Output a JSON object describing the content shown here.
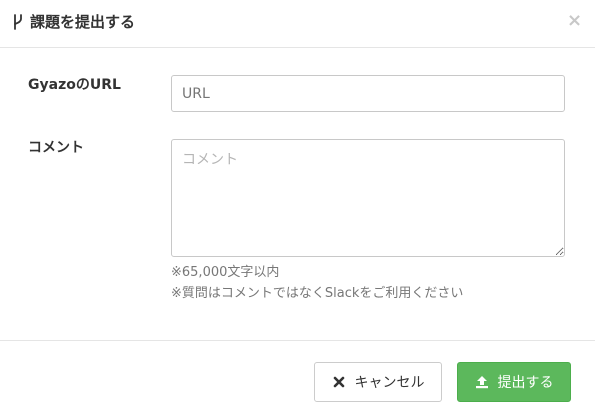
{
  "dialog": {
    "title": "課題を提出する",
    "title_icon": "branch-icon",
    "close_label": "×"
  },
  "form": {
    "url_label": "GyazoのURL",
    "url_placeholder": "URL",
    "comment_label": "コメント",
    "comment_placeholder": "コメント",
    "help_lines": [
      "※65,000文字以内",
      "※質問はコメントではなくSlackをご利用ください"
    ]
  },
  "footer": {
    "cancel_label": "キャンセル",
    "cancel_icon": "close-icon",
    "submit_label": "提出する",
    "submit_icon": "upload-icon"
  },
  "colors": {
    "submit_bg": "#5cb85c",
    "border": "#c8c8c8"
  }
}
